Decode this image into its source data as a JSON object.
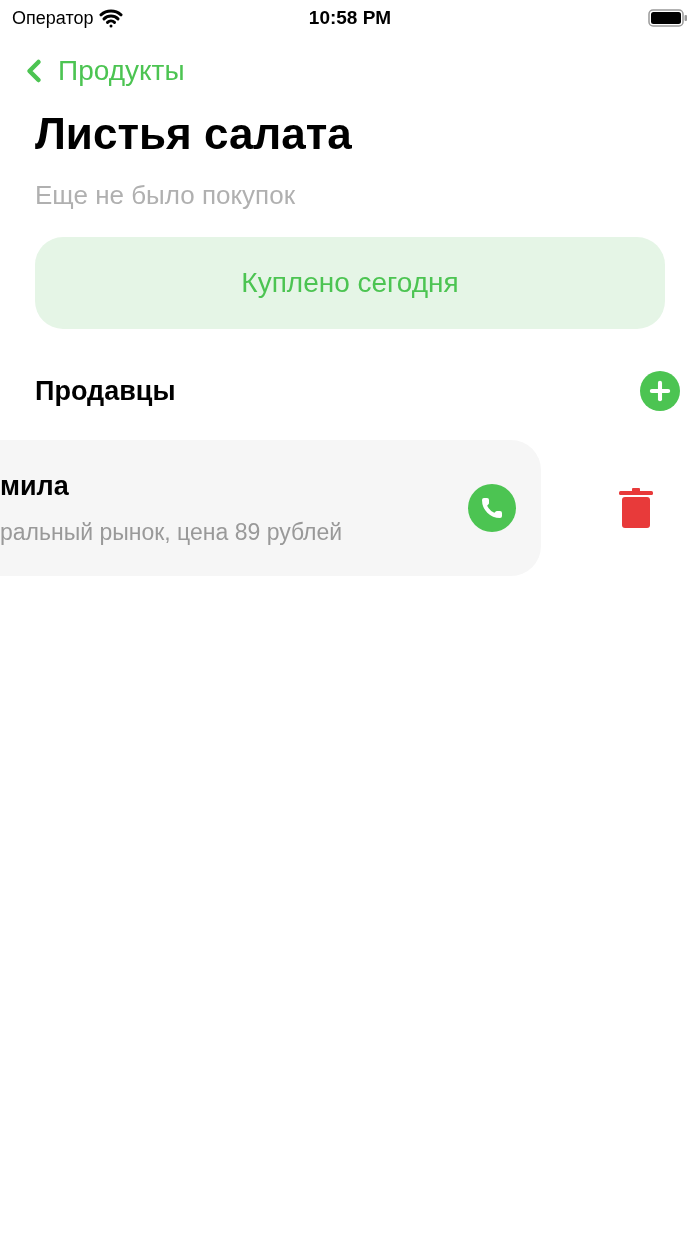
{
  "status_bar": {
    "carrier": "Оператор",
    "time": "10:58 PM"
  },
  "nav": {
    "back_label": "Продукты"
  },
  "title": "Листья салата",
  "subtitle": "Еще не было покупок",
  "bought_button": {
    "label": "Куплено сегодня"
  },
  "sellers": {
    "heading": "Продавцы",
    "items": [
      {
        "name": "мила",
        "details": "ральный рынок, цена 89 рублей"
      }
    ]
  }
}
